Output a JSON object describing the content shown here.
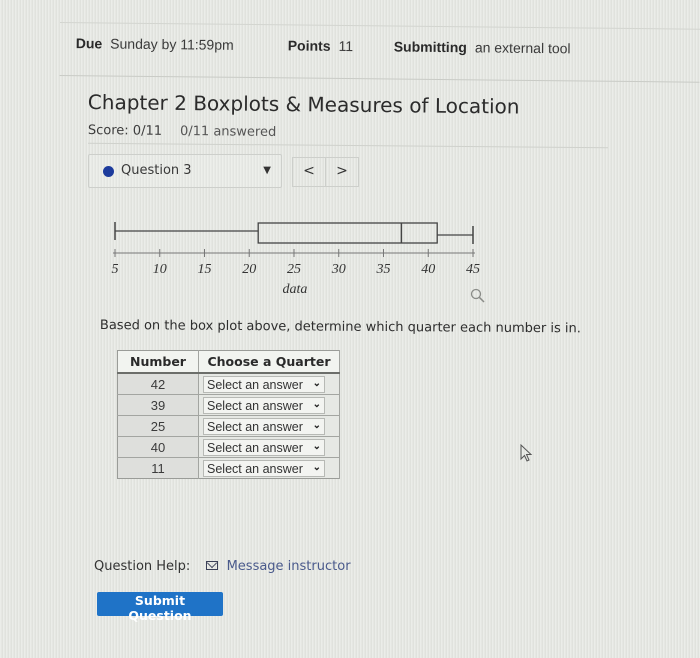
{
  "assignment_meta": {
    "due_label": "Due",
    "due_value": "Sunday by 11:59pm",
    "points_label": "Points",
    "points_value": "11",
    "submitting_label": "Submitting",
    "submitting_value": "an external tool"
  },
  "quiz": {
    "title": "Chapter 2 Boxplots & Measures of Location",
    "score": "Score: 0/11",
    "answered": "0/11 answered"
  },
  "question_nav": {
    "current": "Question 3",
    "caret": "▼",
    "prev": "<",
    "next": ">",
    "status_color": "#1c3b9c"
  },
  "chart_data": {
    "type": "boxplot",
    "orientation": "horizontal",
    "xlabel": "data",
    "ticks": [
      5,
      10,
      15,
      20,
      25,
      30,
      35,
      40,
      45
    ],
    "xlim": [
      5,
      45
    ],
    "min": 5,
    "q1": 21,
    "median": 37,
    "q3": 41,
    "max": 45
  },
  "prompt": "Based on the box plot above, determine which quarter each number is in.",
  "answer_table": {
    "headers": [
      "Number",
      "Choose a Quarter"
    ],
    "rows": [
      {
        "number": "42",
        "selected": "Select an answer"
      },
      {
        "number": "39",
        "selected": "Select an answer"
      },
      {
        "number": "25",
        "selected": "Select an answer"
      },
      {
        "number": "40",
        "selected": "Select an answer"
      },
      {
        "number": "11",
        "selected": "Select an answer"
      }
    ]
  },
  "help": {
    "label": "Question Help:",
    "icon": "envelope-icon",
    "link": "Message instructor"
  },
  "submit_label": "Submit Question",
  "colors": {
    "accent": "#1f73c7",
    "link": "#4a5a8c"
  }
}
